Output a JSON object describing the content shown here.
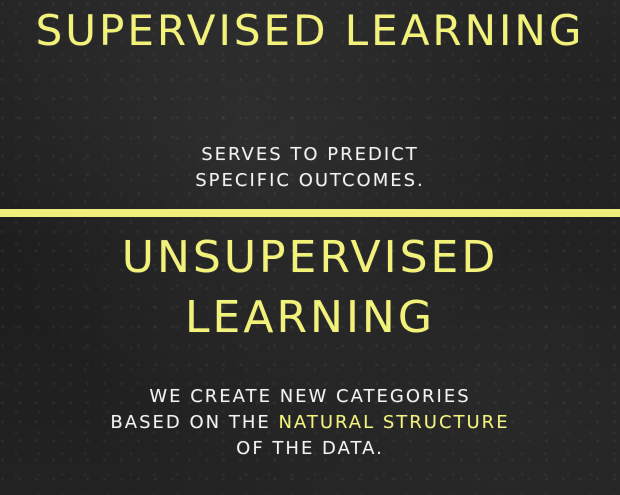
{
  "colors": {
    "chalk_yellow": "#f2f27a",
    "chalk_white": "#f2f2f2",
    "divider": "#f0f07a"
  },
  "supervised": {
    "title": "SUPERVISED LEARNING",
    "description_lines": [
      "SERVES TO PREDICT",
      "SPECIFIC OUTCOMES."
    ]
  },
  "unsupervised": {
    "title_lines": [
      "UNSUPERVISED",
      "LEARNING"
    ],
    "description_line1": "WE CREATE NEW CATEGORIES",
    "description_line2_before": "BASED ON THE ",
    "description_line2_highlight": "NATURAL STRUCTURE",
    "description_line3": "OF THE DATA."
  }
}
